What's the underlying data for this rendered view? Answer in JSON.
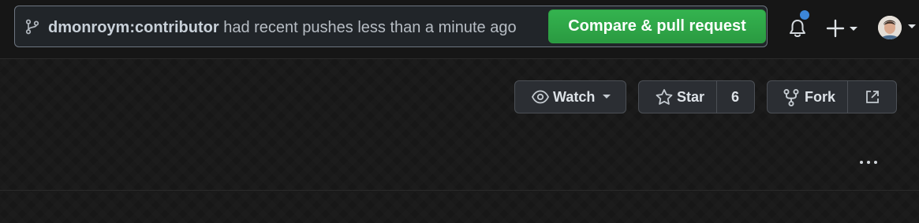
{
  "banner": {
    "branch_name": "dmonroym:contributor",
    "message": " had recent pushes less than a minute ago",
    "compare_label": "Compare & pull request"
  },
  "header_icons": {
    "notifications": "bell-icon",
    "create": "plus-icon",
    "profile": "avatar"
  },
  "repo_actions": {
    "watch_label": "Watch",
    "star_label": "Star",
    "star_count": "6",
    "fork_label": "Fork"
  },
  "colors": {
    "accent_green": "#2ea043",
    "notification_dot": "#3c86d8",
    "background": "#171717"
  }
}
